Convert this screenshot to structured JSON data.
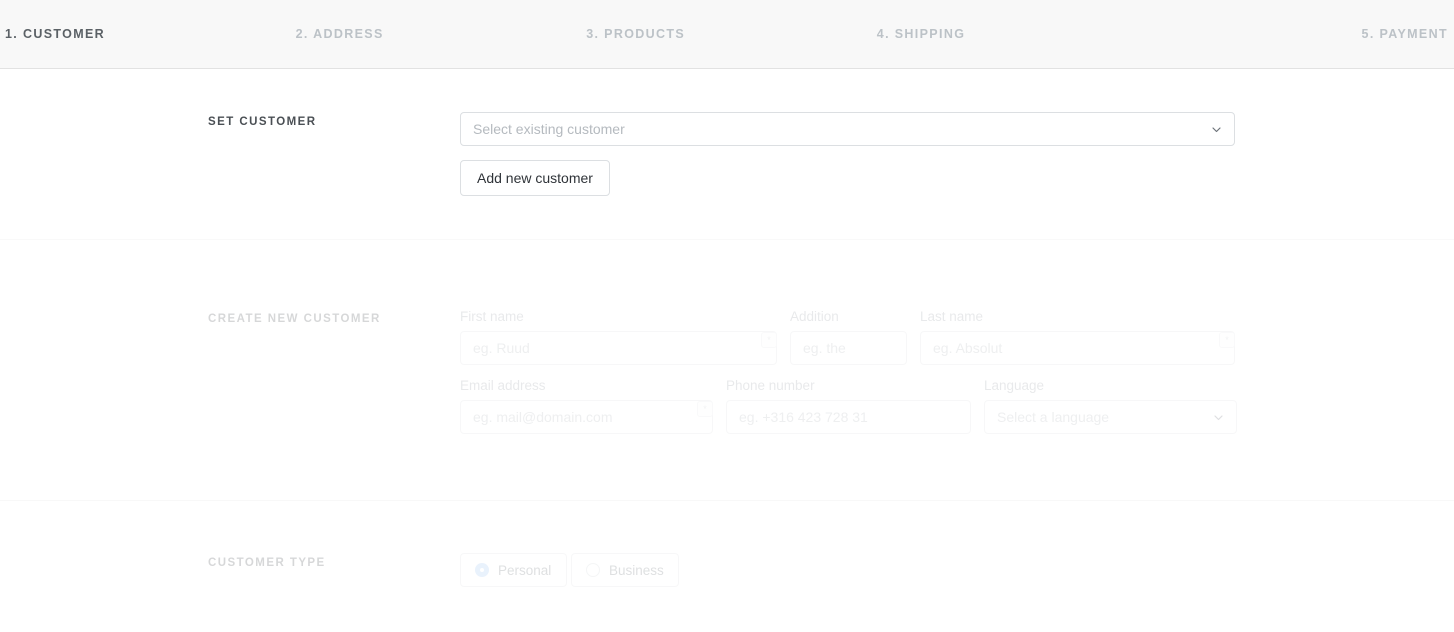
{
  "stepper": {
    "steps": [
      {
        "label": "1. CUSTOMER",
        "active": true
      },
      {
        "label": "2. ADDRESS",
        "active": false
      },
      {
        "label": "3. PRODUCTS",
        "active": false
      },
      {
        "label": "4. SHIPPING",
        "active": false
      },
      {
        "label": "5. PAYMENT",
        "active": false
      }
    ]
  },
  "set_customer": {
    "title": "SET CUSTOMER",
    "select_placeholder": "Select existing customer",
    "add_button_label": "Add new customer",
    "chevron_icon": "chevron-down-icon"
  },
  "create_customer": {
    "title": "CREATE NEW CUSTOMER",
    "fields": {
      "first_name": {
        "label": "First name",
        "placeholder": "eg. Ruud",
        "required": true,
        "required_mark": "*"
      },
      "addition": {
        "label": "Addition",
        "placeholder": "eg. the",
        "required": false
      },
      "last_name": {
        "label": "Last name",
        "placeholder": "eg. Absolut",
        "required": true,
        "required_mark": "*"
      },
      "email": {
        "label": "Email address",
        "placeholder": "eg. mail@domain.com",
        "required": true,
        "required_mark": "*"
      },
      "phone": {
        "label": "Phone number",
        "placeholder": "eg. +316 423 728 31",
        "required": false
      },
      "language": {
        "label": "Language",
        "placeholder": "Select a language",
        "required": false,
        "chevron_icon": "chevron-down-icon"
      }
    }
  },
  "customer_type": {
    "title": "CUSTOMER TYPE",
    "options": [
      {
        "label": "Personal",
        "selected": true
      },
      {
        "label": "Business",
        "selected": false
      }
    ]
  },
  "colors": {
    "header_bg": "#f8f8f8",
    "border": "#e4e4e4",
    "active_step": "#5b6166",
    "inactive_step": "#bcc2c7",
    "accent_radio": "#9ec5f5",
    "placeholder": "#b5babf"
  }
}
